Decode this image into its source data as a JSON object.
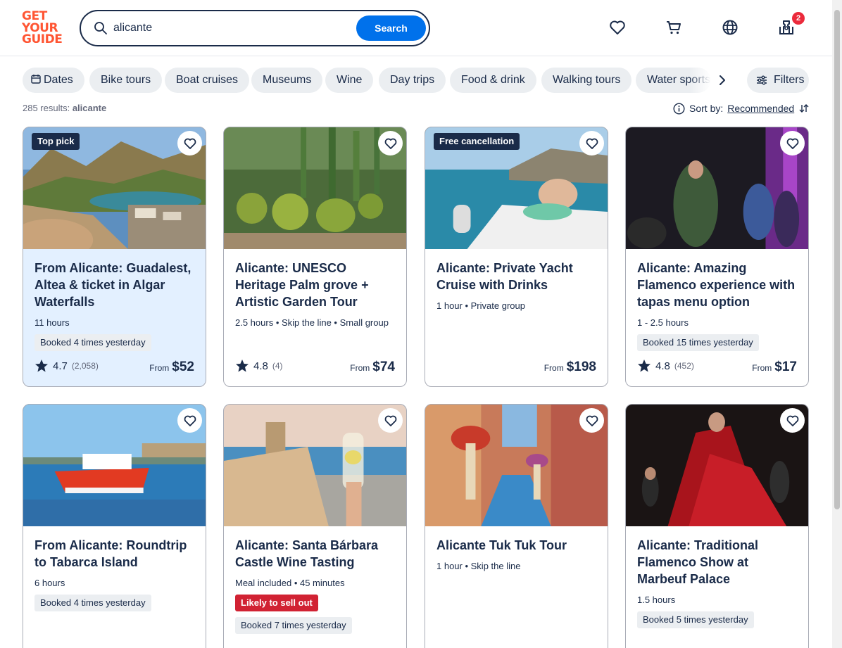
{
  "logo": {
    "line1": "GET",
    "line2": "YOUR",
    "line3": "GUIDE"
  },
  "search": {
    "value": "alicante",
    "button": "Search"
  },
  "cart_badge": "2",
  "chips": [
    "Dates",
    "Bike tours",
    "Boat cruises",
    "Museums",
    "Wine",
    "Day trips",
    "Food & drink",
    "Walking tours",
    "Water sports"
  ],
  "filters_label": "Filters",
  "results": {
    "count_text": "285 results:",
    "query": "alicante"
  },
  "sort": {
    "label": "Sort by:",
    "value": "Recommended"
  },
  "cards": [
    {
      "tag": "Top pick",
      "title": "From Alicante: Guadalest, Altea & ticket in Algar Waterfalls",
      "meta": "11 hours",
      "booked": "Booked 4 times yesterday",
      "rating": "4.7",
      "reviews": "(2,058)",
      "from": "From",
      "price": "$52"
    },
    {
      "tag": "",
      "title": "Alicante: UNESCO Heritage Palm grove + Artistic Garden Tour",
      "meta": "2.5 hours • Skip the line • Small group",
      "booked": "",
      "rating": "4.8",
      "reviews": "(4)",
      "from": "From",
      "price": "$74"
    },
    {
      "tag": "Free cancellation",
      "title": "Alicante: Private Yacht Cruise with Drinks",
      "meta": "1 hour • Private group",
      "booked": "",
      "rating": "",
      "reviews": "",
      "from": "From",
      "price": "$198"
    },
    {
      "tag": "",
      "title": "Alicante: Amazing Flamenco experience with tapas menu option",
      "meta": "1 - 2.5 hours",
      "booked": "Booked 15 times yesterday",
      "rating": "4.8",
      "reviews": "(452)",
      "from": "From",
      "price": "$17"
    },
    {
      "tag": "",
      "title": "From Alicante: Roundtrip to Tabarca Island",
      "meta": "6 hours",
      "booked": "Booked 4 times yesterday"
    },
    {
      "tag": "",
      "title": "Alicante: Santa Bárbara Castle Wine Tasting",
      "meta": "Meal included • 45 minutes",
      "likely": "Likely to sell out",
      "booked": "Booked 7 times yesterday"
    },
    {
      "tag": "",
      "title": "Alicante Tuk Tuk Tour",
      "meta": "1 hour • Skip the line"
    },
    {
      "tag": "",
      "title": "Alicante: Traditional Flamenco Show at Marbeuf Palace",
      "meta": "1.5 hours",
      "booked": "Booked 5 times yesterday"
    }
  ],
  "colors": {
    "brand": "#ff5533",
    "accent": "#0071eb",
    "text": "#1a2b49",
    "highlight_card": "#e3f0ff",
    "likely_badge": "#d12233"
  }
}
